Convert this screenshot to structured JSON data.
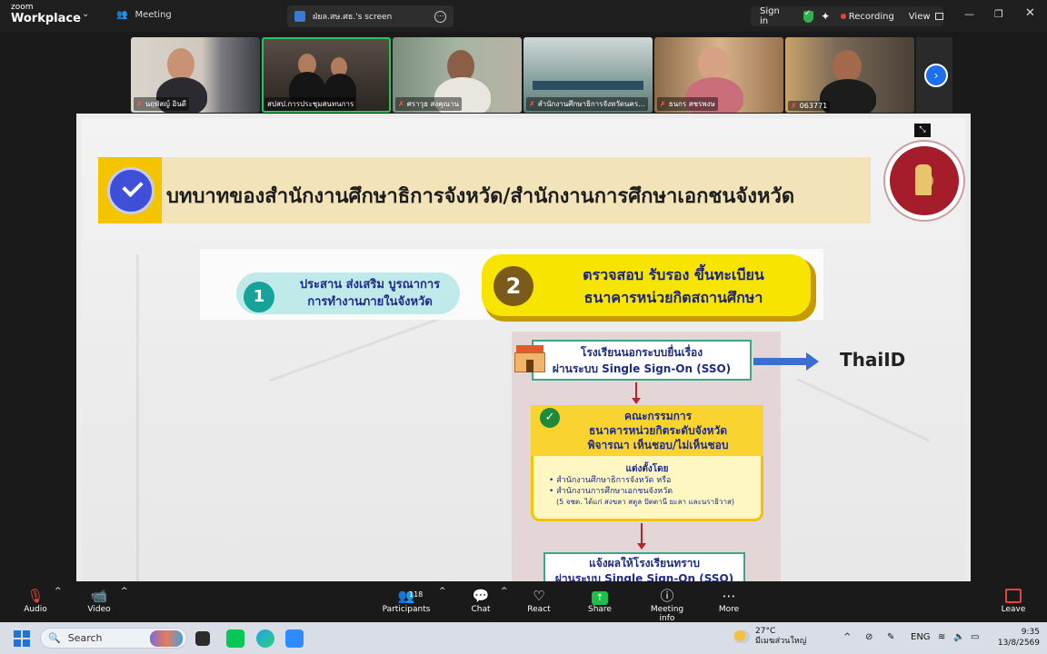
{
  "window": {
    "brand_small": "zoom",
    "brand_big": "Workplace",
    "meeting_tab": "Meeting",
    "screen_tab": "ฝ่ยล.สษ.ศธ.'s screen",
    "sign_in": "Sign in",
    "recording": "Recording",
    "view": "View",
    "colors": {
      "bg": "#1a1a1a",
      "active_tile": "#22c55e",
      "recording_dot": "#e5443d",
      "accent_blue": "#1e6ff0"
    }
  },
  "participants": [
    {
      "name": "นฤพัสญ์ อินดี",
      "muted": true
    },
    {
      "name": "สปสป.การประชุมสนทนการ",
      "muted": false
    },
    {
      "name": "ศราวุธ สงคุณาน",
      "muted": true
    },
    {
      "name": "สำนักงานศึกษาธิการจังหวัดนคร...",
      "muted": true
    },
    {
      "name": "ธนกร สชรพงษ",
      "muted": true
    },
    {
      "name": "063771",
      "muted": true
    }
  ],
  "slide": {
    "title": "บทบาทของสำนักงานศึกษาธิการจังหวัด/สำนักงานการศึกษาเอกชนจังหวัด",
    "step1_num": "1",
    "step1_line1": "ประสาน ส่งเสริม บูรณาการ",
    "step1_line2": "การทำงานภายในจังหวัด",
    "step2_num": "2",
    "step2_line1": "ตรวจสอบ รับรอง ขึ้นทะเบียน",
    "step2_line2": "ธนาคารหน่วยกิตสถานศึกษา",
    "box1_line1": "โรงเรียนนอกระบบยื่นเรื่อง",
    "box1_line2": "ผ่านระบบ Single Sign-On (SSO)",
    "thaiid": "ThaiID",
    "box2_line1": "คณะกรรมการ",
    "box2_line2": "ธนาคารหน่วยกิตระดับจังหวัด",
    "box2_line3": "พิจารณา เห็นชอบ/ไม่เห็นชอบ",
    "box2_sub": "แต่งตั้งโดย",
    "box2_item1": "สำนักงานศึกษาธิการจังหวัด หรือ",
    "box2_item2": "สำนักงานการศึกษาเอกชนจังหวัด",
    "box2_note": "(5 จชต. ได้แก่ สงขลา สตูล ปัตตานี ยะลา และนราธิวาส)",
    "box3_line1": "แจ้งผลให้โรงเรียนทราบ",
    "box3_line2": "ผ่านระบบ Single Sign-On (SSO)"
  },
  "toolbar": {
    "audio": "Audio",
    "video": "Video",
    "participants": "Participants",
    "participants_count": "118",
    "chat": "Chat",
    "react": "React",
    "share": "Share",
    "meeting_info": "Meeting info",
    "more": "More",
    "leave": "Leave"
  },
  "taskbar": {
    "search": "Search",
    "temp": "27°C",
    "weather": "มีเมฆส่วนใหญ่",
    "lang": "ENG",
    "time": "9:35",
    "date": "13/8/2569"
  }
}
